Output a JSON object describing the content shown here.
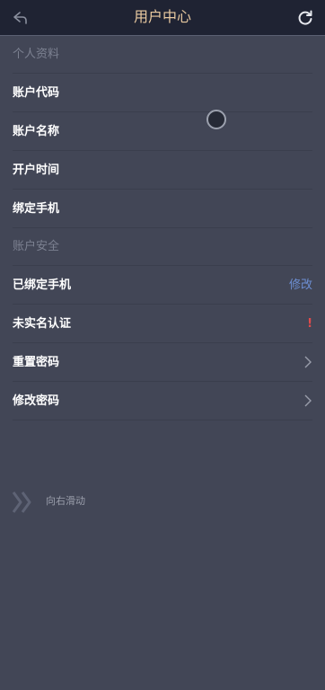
{
  "header": {
    "title": "用户中心",
    "back_icon": "back-arrow-icon",
    "refresh_icon": "refresh-icon",
    "title_color": "#e8c9a0"
  },
  "sections": {
    "profile": {
      "title": "个人资料",
      "rows": [
        {
          "label": "账户代码"
        },
        {
          "label": "账户名称"
        },
        {
          "label": "开户时间"
        },
        {
          "label": "绑定手机"
        }
      ]
    },
    "security": {
      "title": "账户安全",
      "rows": [
        {
          "label": "已绑定手机",
          "action": "修改"
        },
        {
          "label": "未实名认证",
          "badge": "!"
        },
        {
          "label": "重置密码"
        },
        {
          "label": "修改密码"
        }
      ]
    }
  },
  "swipe_hint": {
    "text": "向右滑动",
    "icon": "double-chevron-right-icon"
  },
  "colors": {
    "background": "#424656",
    "header_bg": "#1f2333",
    "link": "#6d8fd3",
    "warning": "#e04b4b"
  }
}
